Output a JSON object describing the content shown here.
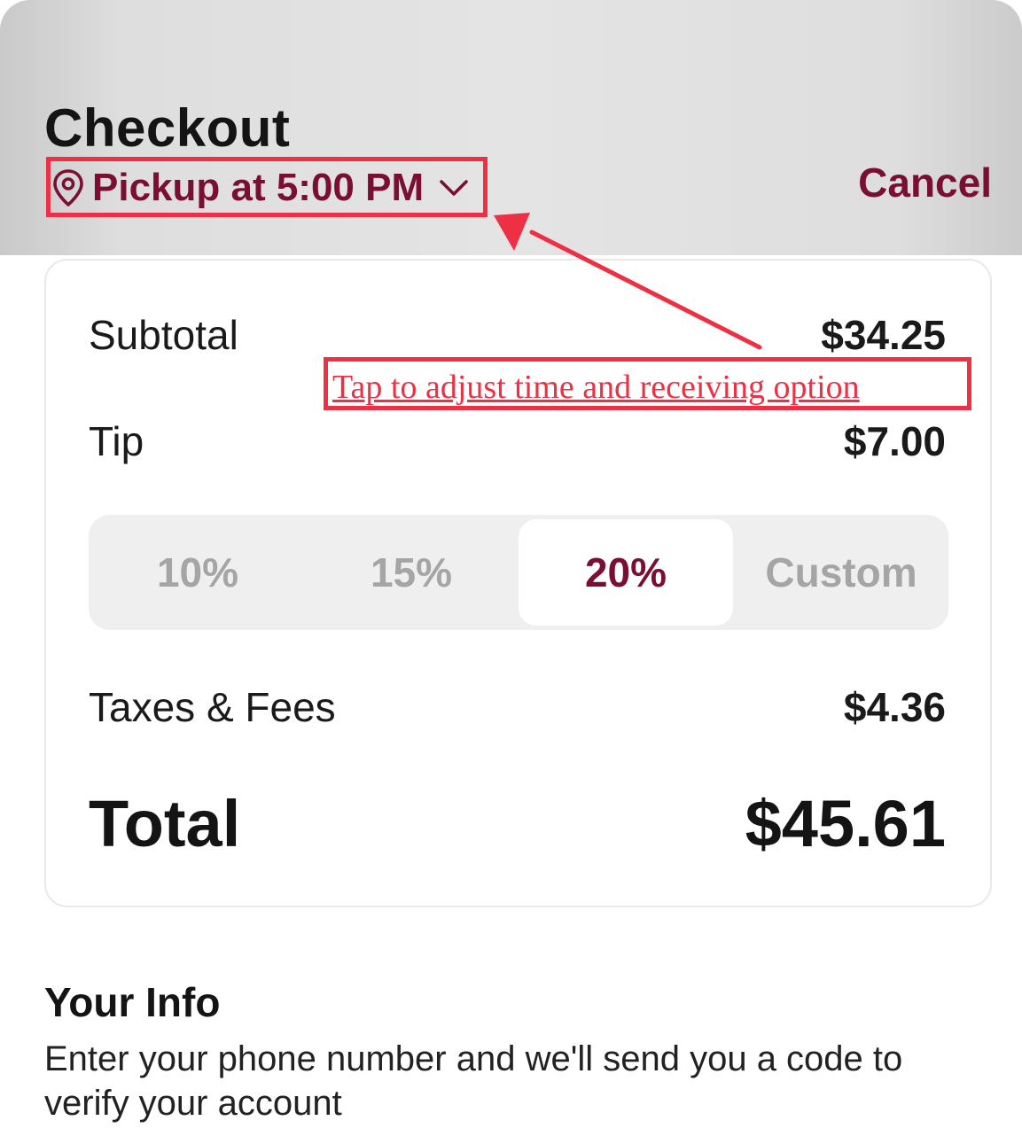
{
  "header": {
    "title": "Checkout",
    "pickup_label": "Pickup at 5:00 PM",
    "cancel_label": "Cancel"
  },
  "summary": {
    "subtotal_label": "Subtotal",
    "subtotal_value": "$34.25",
    "tip_label": "Tip",
    "tip_value": "$7.00",
    "tip_options": [
      "10%",
      "15%",
      "20%",
      "Custom"
    ],
    "tip_selected": "20%",
    "taxes_label": "Taxes & Fees",
    "taxes_value": "$4.36",
    "total_label": "Total",
    "total_value": "$45.61"
  },
  "info": {
    "title": "Your Info",
    "description": "Enter your phone number and we'll send you a code to verify your account"
  },
  "annotation": {
    "note": "Tap to adjust time and receiving option"
  },
  "icons": {
    "pickup": "location-pin-icon",
    "dropdown": "chevron-down-icon",
    "annotation_arrow": "arrow-icon"
  },
  "colors": {
    "accent": "#7a0f33",
    "annotation": "#ee3045",
    "header_bg": "#e4e4e4",
    "tip_bar_bg": "#efefef"
  }
}
